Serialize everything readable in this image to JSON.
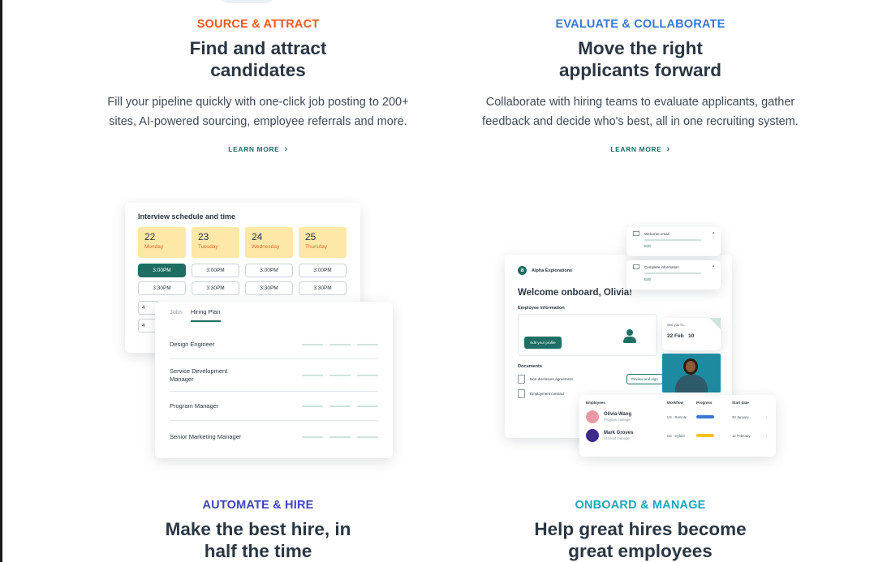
{
  "sections": [
    {
      "eyebrow": "SOURCE & ATTRACT",
      "eyebrow_color": "#f2581f",
      "heading": "Find and attract candidates",
      "description": "Fill your pipeline quickly with one-click job posting to 200+ sites, AI-powered sourcing, employee referrals and more.",
      "learn_more": "LEARN MORE"
    },
    {
      "eyebrow": "EVALUATE & COLLABORATE",
      "eyebrow_color": "#3a77d6",
      "heading": "Move the right applicants forward",
      "description": "Collaborate with hiring teams to evaluate applicants, gather feedback and decide who's best, all in one recruiting system.",
      "learn_more": "LEARN MORE"
    },
    {
      "eyebrow": "AUTOMATE & HIRE",
      "eyebrow_color": "#3d46b8",
      "heading": "Make the best hire, in half the time"
    },
    {
      "eyebrow": "ONBOARD & MANAGE",
      "eyebrow_color": "#1fa6b8",
      "heading": "Help great hires become great employees"
    }
  ],
  "schedule": {
    "title": "Interview schedule and time",
    "days": [
      {
        "num": "22",
        "name": "Monday"
      },
      {
        "num": "23",
        "name": "Tuesday"
      },
      {
        "num": "24",
        "name": "Wednesday"
      },
      {
        "num": "25",
        "name": "Thursday"
      }
    ],
    "row1": [
      "3:00PM",
      "3:00PM",
      "3:00PM",
      "3:00PM"
    ],
    "row2": [
      "3:30PM",
      "3:30PM",
      "3:30PM",
      "3:30PM"
    ],
    "stub1": "4",
    "stub2": "4"
  },
  "plan": {
    "tabs": [
      "Jobs",
      "Hiring Plan"
    ],
    "roles": [
      "Design Engineer",
      "Service Development Manager",
      "Program Manager",
      "Senior Marketing Manager"
    ]
  },
  "onboarding": {
    "brand": "Alpha Explorations",
    "brand_logo": "a",
    "welcome": "Welcome onboard, Olivia!",
    "employee_info": "Employee information",
    "edit_profile": "Edit your profile",
    "documents": "Documents",
    "doc1": "Non-disclosure agreement",
    "review_sign": "Review and sign",
    "doc2": "Employment contract",
    "mini1": {
      "title": "Welcome email",
      "edit": "Edit"
    },
    "mini2": {
      "title": "Complete information",
      "edit": "Edit"
    },
    "date_caption": "See you in...",
    "date_value": "22 Feb",
    "date_days": "10",
    "employees": {
      "headers": [
        "Employees",
        "Workflow",
        "Progress",
        "Start date"
      ],
      "rows": [
        {
          "name": "Olivia Wang",
          "role": "Program manager",
          "workflow": "US - Remote",
          "start": "30 January",
          "bar_color": "#3a77d6"
        },
        {
          "name": "Mark Groves",
          "role": "Account manager",
          "workflow": "US - Hybrid",
          "start": "12 February",
          "bar_color": "#f5c10e"
        }
      ]
    }
  }
}
